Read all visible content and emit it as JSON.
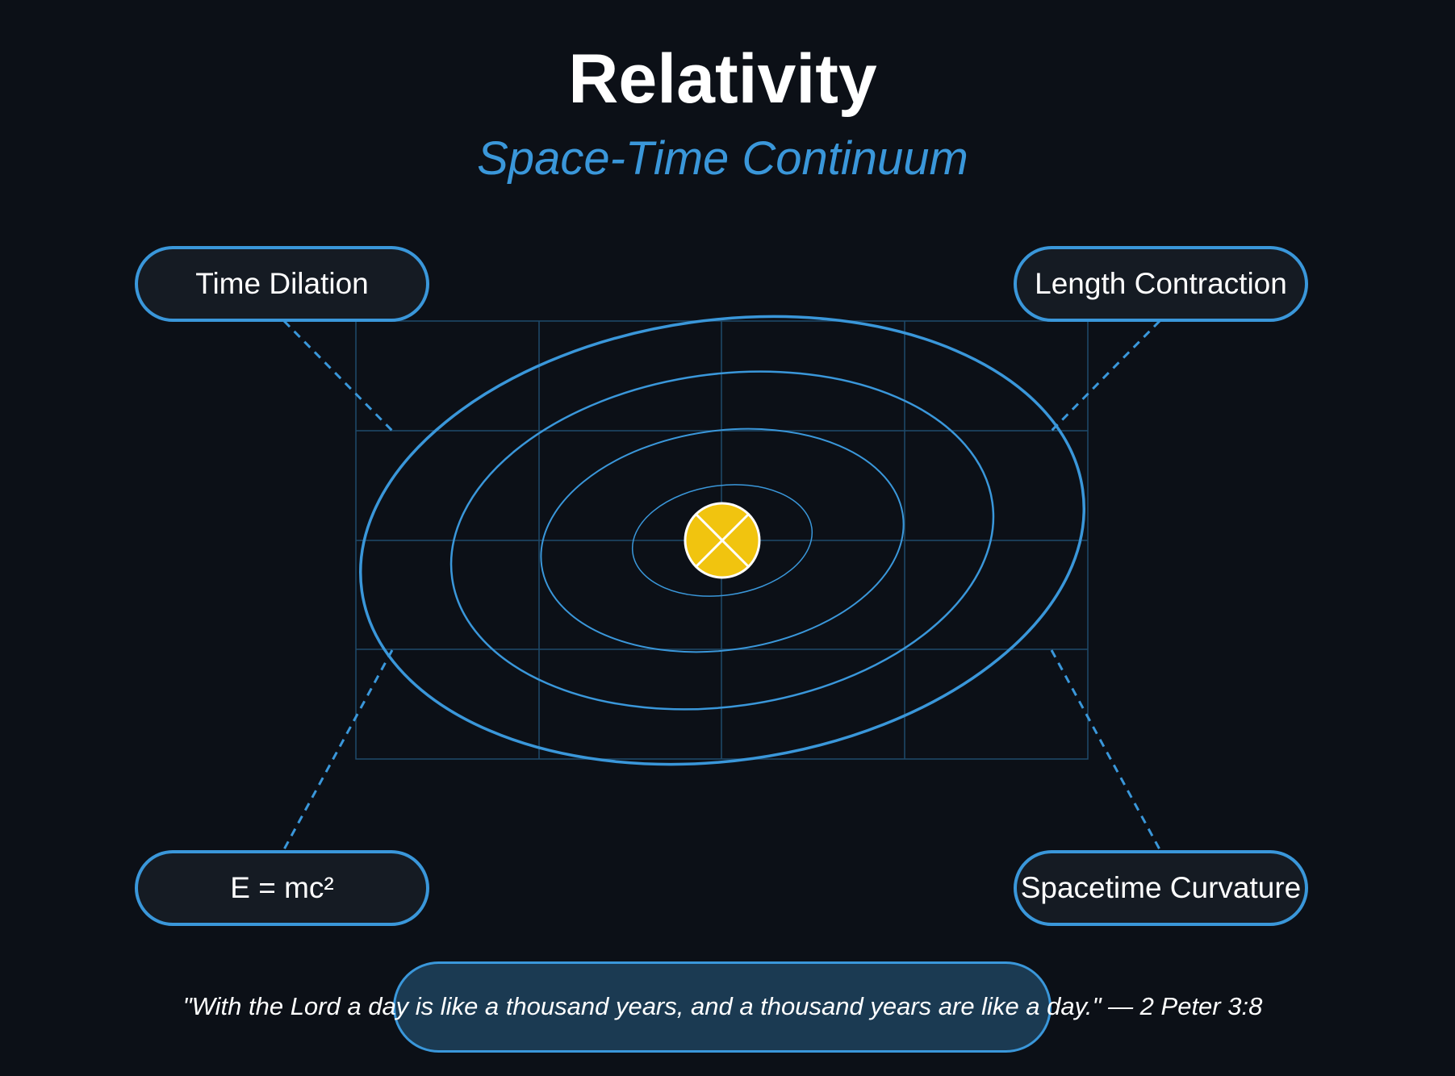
{
  "header": {
    "title": "Relativity",
    "subtitle": "Space-Time Continuum"
  },
  "concepts": {
    "top_left": "Time Dilation",
    "top_right": "Length Contraction",
    "bottom_left": "E = mc²",
    "bottom_right": "Spacetime Curvature"
  },
  "quote": "\"With the Lord a day is like a thousand years, and a thousand years are like a day.\" — 2 Peter 3:8",
  "colors": {
    "background": "#0c1017",
    "accent": "#3a97da",
    "grid": "#1f4a6b",
    "star": "#f1c40f",
    "pill_fill": "#151b23",
    "quote_fill": "#1b3a52",
    "text": "#ffffff"
  },
  "icons": {
    "central_mass": "star-with-cross-icon"
  }
}
